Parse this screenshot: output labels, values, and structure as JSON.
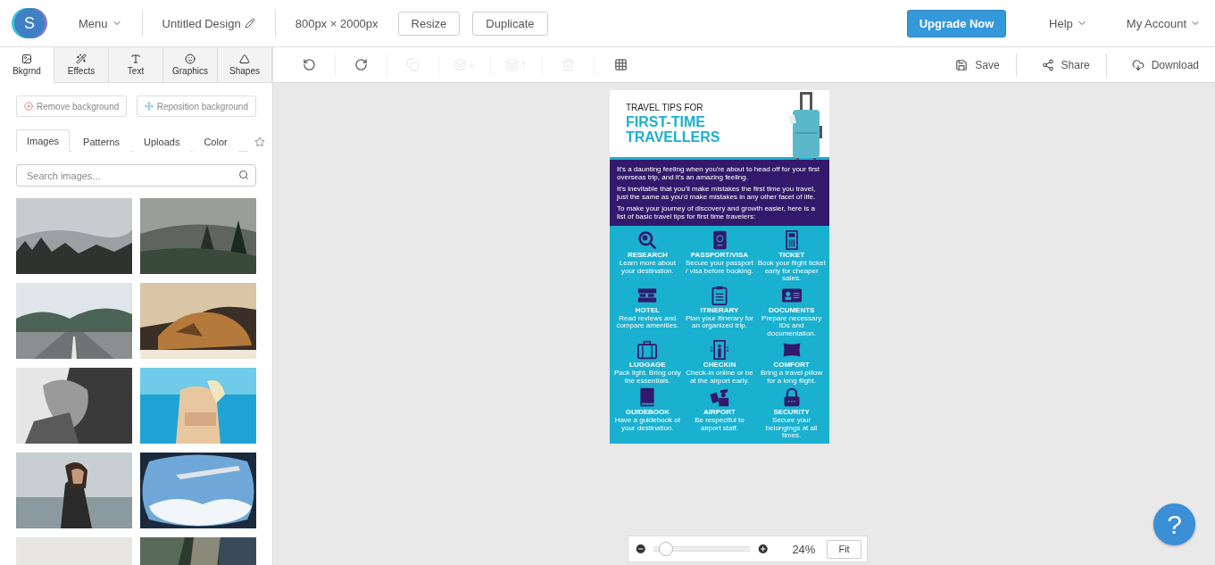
{
  "header": {
    "logo_letter": "S",
    "menu": "Menu",
    "design_name": "Untitled Design",
    "dimensions": "800px × 2000px",
    "buttons": [
      "Resize",
      "Duplicate"
    ],
    "upgrade": "Upgrade Now",
    "help": "Help",
    "account": "My Account"
  },
  "panel_tabs": [
    {
      "kind": "background",
      "label": "Bkgrnd",
      "selected": true
    },
    {
      "kind": "effects",
      "label": "Effects",
      "selected": false
    },
    {
      "kind": "text",
      "label": "Text",
      "selected": false
    },
    {
      "kind": "graphics",
      "label": "Graphics",
      "selected": false
    },
    {
      "kind": "shapes",
      "label": "Shapes",
      "selected": false
    }
  ],
  "toolbar": [
    {
      "kind": "undo",
      "disabled": false
    },
    {
      "kind": "redo",
      "disabled": false
    },
    {
      "kind": "copy",
      "disabled": true
    },
    {
      "kind": "send_back",
      "disabled": true
    },
    {
      "kind": "bring_forward",
      "disabled": true
    },
    {
      "kind": "delete",
      "disabled": true
    },
    {
      "kind": "grid",
      "disabled": false
    }
  ],
  "right_actions": [
    {
      "kind": "save",
      "label": "Save"
    },
    {
      "kind": "share",
      "label": "Share"
    },
    {
      "kind": "download",
      "label": "Download"
    }
  ],
  "background_buttons": [
    {
      "kind": "remove",
      "label": "Remove background"
    },
    {
      "kind": "reposition",
      "label": "Reposition background"
    }
  ],
  "image_tabs": [
    {
      "kind": "text",
      "label": "Images",
      "selected": true
    },
    {
      "kind": "text",
      "label": "Patterns",
      "selected": false
    },
    {
      "kind": "text",
      "label": "Uploads",
      "selected": false
    },
    {
      "kind": "text",
      "label": "Color",
      "selected": false
    },
    {
      "kind": "favorites",
      "selected": false
    }
  ],
  "search": {
    "placeholder": "Search images..."
  },
  "infographic": {
    "title_small": "TRAVEL TIPS FOR",
    "title_big": [
      "FIRST-TIME",
      "TRAVELLERS"
    ],
    "intro": [
      "It's a daunting feeling when you're about to head off for your first overseas trip, and it's an amazing feeling.",
      "It's inevitable that you'll make mistakes the first time you travel, just the same as you'd make mistakes in any other facet of life.",
      "To make your journey of discovery and growth easier, here is a list of basic travel tips for first time travelers:"
    ],
    "tips": [
      {
        "kind": "research",
        "title": "RESEARCH",
        "text": "Learn more about your destination."
      },
      {
        "kind": "passport",
        "title": "PASSPORT/VISA",
        "text": "Secure your passport / visa before booking."
      },
      {
        "kind": "ticket",
        "title": "TICKET",
        "text": "Book your flight ticket early for cheaper sales."
      },
      {
        "kind": "hotel",
        "title": "HOTEL",
        "text": "Read reviews and compare amenities."
      },
      {
        "kind": "itinerary",
        "title": "ITINERARY",
        "text": "Plan your itinerary for an organized trip."
      },
      {
        "kind": "documents",
        "title": "DOCUMENTS",
        "text": "Prepare necessary IDs and documentation."
      },
      {
        "kind": "luggage",
        "title": "LUGGAGE",
        "text": "Pack light. Bring only the essentials."
      },
      {
        "kind": "checkin",
        "title": "CHECKIN",
        "text": "Check-in online or be at the airport early."
      },
      {
        "kind": "comfort",
        "title": "COMFORT",
        "text": "Bring a travel pillow for a long flight."
      },
      {
        "kind": "guidebook",
        "title": "GUIDEBOOK",
        "text": "Have a guidebook of your destination."
      },
      {
        "kind": "airport",
        "title": "AIRPORT",
        "text": "Be respectful to airport staff."
      },
      {
        "kind": "security",
        "title": "SECURITY",
        "text": "Secure your belongings at all times."
      }
    ]
  },
  "zoom": {
    "level": 0.05,
    "reading": "24%",
    "fit": "Fit"
  },
  "help_button": "?"
}
